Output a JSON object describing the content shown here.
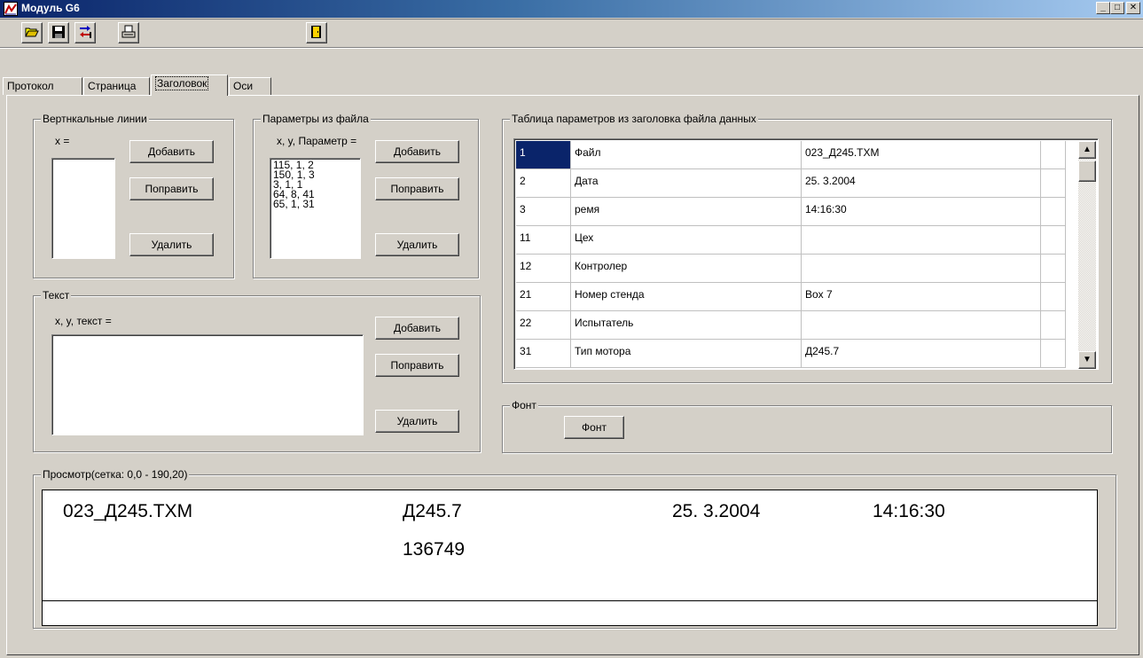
{
  "window": {
    "title": "Модуль G6",
    "minimize_glyph": "_",
    "maximize_glyph": "□",
    "close_glyph": "✕"
  },
  "toolbar": {
    "open_icon": "folder-open-icon",
    "save_icon": "floppy-disk-icon",
    "transfer_icon": "transfer-icon",
    "print_icon": "printer-icon",
    "exit_icon": "exit-door-icon"
  },
  "tabs": [
    {
      "label": "Протокол"
    },
    {
      "label": "Страница"
    },
    {
      "label": "Заголовок"
    },
    {
      "label": "Оси"
    }
  ],
  "active_tab": "Заголовок",
  "vertical_lines": {
    "title": "Вертнкальные линии",
    "x_label": "x =",
    "add": "Добавить",
    "edit": "Поправить",
    "delete": "Удалить"
  },
  "file_params": {
    "title": "Параметры из файла",
    "label": "x, y, Параметр =",
    "items": [
      "115, 1, 2",
      "150, 1, 3",
      "3, 1, 1",
      "64, 8, 41",
      "65, 1, 31"
    ],
    "add": "Добавить",
    "edit": "Поправить",
    "delete": "Удалить"
  },
  "text_group": {
    "title": "Текст",
    "label": "x, y, текст =",
    "add": "Добавить",
    "edit": "Поправить",
    "delete": "Удалить"
  },
  "param_table": {
    "title": "Таблица параметров из заголовка файла данных",
    "rows": [
      {
        "id": "1",
        "name": "Файл",
        "value": "023_Д245.TXM"
      },
      {
        "id": "2",
        "name": "Дата",
        "value": "25. 3.2004"
      },
      {
        "id": "3",
        "name": "ремя",
        "value": "14:16:30"
      },
      {
        "id": "11",
        "name": "Цех",
        "value": ""
      },
      {
        "id": "12",
        "name": "Контролер",
        "value": ""
      },
      {
        "id": "21",
        "name": "Номер стенда",
        "value": "Box 7"
      },
      {
        "id": "22",
        "name": "Испытатель",
        "value": ""
      },
      {
        "id": "31",
        "name": "Тип мотора",
        "value": "Д245.7"
      }
    ],
    "scroll_up": "▲",
    "scroll_down": "▼"
  },
  "font_group": {
    "title": "Фонт",
    "button": "Фонт"
  },
  "preview": {
    "title": "Просмотр(сетка: 0,0 - 190,20)",
    "items": [
      {
        "text": "023_Д245.TXM"
      },
      {
        "text": "Д245.7"
      },
      {
        "text": "25. 3.2004"
      },
      {
        "text": "14:16:30"
      },
      {
        "text": "136749"
      }
    ]
  }
}
